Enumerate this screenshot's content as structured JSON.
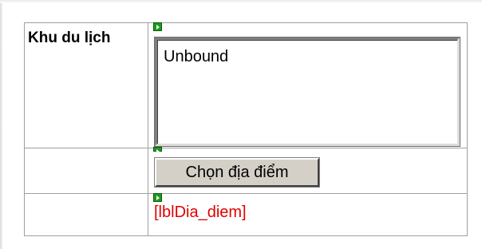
{
  "form": {
    "row1": {
      "label": "Khu du lịch",
      "textbox_value": "Unbound"
    },
    "row2": {
      "button_label": "Chọn địa điểm"
    },
    "row3": {
      "label_control_text": "[lblDia_diem]"
    }
  },
  "icons": {
    "anchor": "smart-tag-anchor-icon"
  },
  "colors": {
    "grid_line": "#a0a0a0",
    "button_face": "#d4d0c8",
    "label_text": "#e00000",
    "anchor_green": "#1c9a1c"
  }
}
